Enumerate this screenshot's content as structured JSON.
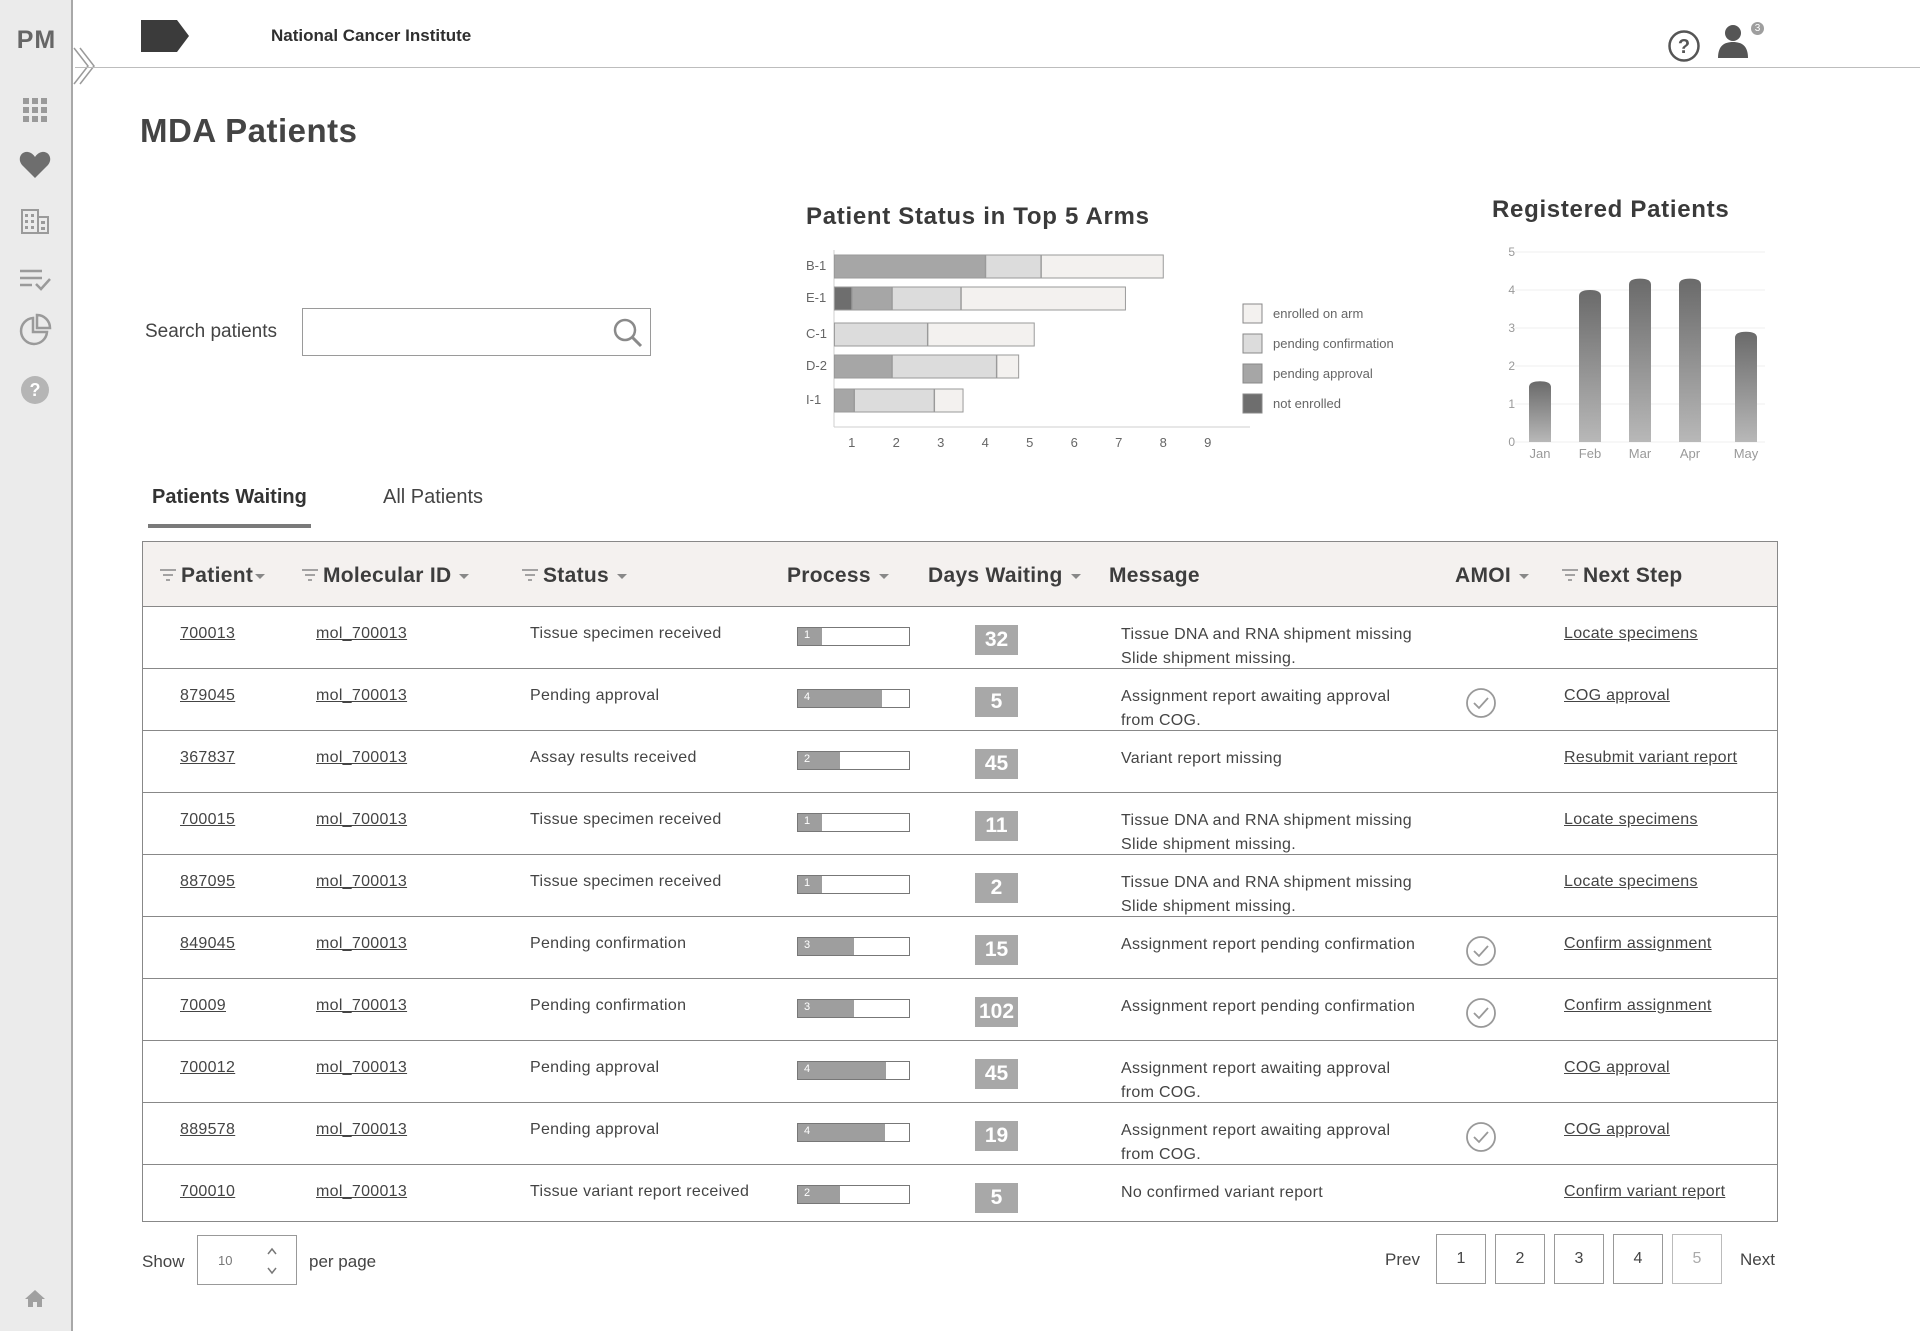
{
  "app": {
    "logo_text": "PM",
    "org_name": "National Cancer Institute",
    "notification_count": "3"
  },
  "sidebar": {
    "items": [
      {
        "icon": "grid-icon"
      },
      {
        "icon": "heart-icon"
      },
      {
        "icon": "building-icon"
      },
      {
        "icon": "checklist-icon"
      },
      {
        "icon": "pie-chart-icon"
      },
      {
        "icon": "help-icon"
      }
    ]
  },
  "page": {
    "title": "MDA Patients"
  },
  "search": {
    "label": "Search patients",
    "value": "",
    "placeholder": ""
  },
  "tabs": [
    {
      "label": "Patients Waiting",
      "active": true
    },
    {
      "label": "All Patients",
      "active": false
    }
  ],
  "table": {
    "headers": {
      "patient": "Patient",
      "molecular_id": "Molecular ID",
      "status": "Status",
      "process": "Process",
      "days_waiting": "Days Waiting",
      "message": "Message",
      "amoi": "AMOI",
      "next_step": "Next Step"
    },
    "rows": [
      {
        "patient": "700013",
        "molecular_id": "mol_700013",
        "status": "Tissue specimen received",
        "process": 1,
        "process_fill": 0.22,
        "days": "32",
        "message": [
          "Tissue DNA and RNA shipment missing",
          "Slide shipment missing."
        ],
        "amoi": false,
        "next_step": "Locate specimens"
      },
      {
        "patient": "879045",
        "molecular_id": "mol_700013",
        "status": "Pending approval",
        "process": 4,
        "process_fill": 0.76,
        "days": "5",
        "message": [
          "Assignment report awaiting approval",
          "from COG."
        ],
        "amoi": true,
        "next_step": "COG approval"
      },
      {
        "patient": "367837",
        "molecular_id": "mol_700013",
        "status": "Assay results received",
        "process": 2,
        "process_fill": 0.38,
        "days": "45",
        "message": [
          "Variant report missing",
          ""
        ],
        "amoi": false,
        "next_step": "Resubmit variant report"
      },
      {
        "patient": "700015",
        "molecular_id": "mol_700013",
        "status": "Tissue specimen received",
        "process": 1,
        "process_fill": 0.22,
        "days": "11",
        "message": [
          "Tissue DNA and RNA shipment missing",
          "Slide shipment missing."
        ],
        "amoi": false,
        "next_step": "Locate specimens"
      },
      {
        "patient": "887095",
        "molecular_id": "mol_700013",
        "status": "Tissue specimen received",
        "process": 1,
        "process_fill": 0.22,
        "days": "2",
        "message": [
          "Tissue DNA and RNA shipment missing",
          "Slide shipment missing."
        ],
        "amoi": false,
        "next_step": "Locate specimens"
      },
      {
        "patient": "849045",
        "molecular_id": "mol_700013",
        "status": "Pending confirmation",
        "process": 3,
        "process_fill": 0.5,
        "days": "15",
        "message": [
          "Assignment report pending confirmation",
          ""
        ],
        "amoi": true,
        "next_step": "Confirm assignment"
      },
      {
        "patient": "70009",
        "molecular_id": "mol_700013",
        "status": "Pending confirmation",
        "process": 3,
        "process_fill": 0.5,
        "days": "102",
        "message": [
          "Assignment report pending confirmation",
          ""
        ],
        "amoi": true,
        "next_step": "Confirm assignment"
      },
      {
        "patient": "700012",
        "molecular_id": "mol_700013",
        "status": "Pending approval",
        "process": 4,
        "process_fill": 0.79,
        "days": "45",
        "message": [
          "Assignment report awaiting approval",
          "from COG."
        ],
        "amoi": false,
        "next_step": "COG approval"
      },
      {
        "patient": "889578",
        "molecular_id": "mol_700013",
        "status": "Pending approval",
        "process": 4,
        "process_fill": 0.78,
        "days": "19",
        "message": [
          "Assignment report awaiting approval",
          "from COG."
        ],
        "amoi": true,
        "next_step": "COG approval"
      },
      {
        "patient": "700010",
        "molecular_id": "mol_700013",
        "status": "Tissue variant report received",
        "process": 2,
        "process_fill": 0.38,
        "days": "5",
        "message": [
          "No confirmed variant report",
          ""
        ],
        "amoi": false,
        "next_step": "Confirm variant report"
      }
    ]
  },
  "pagination": {
    "show_label": "Show",
    "per_page_value": "10",
    "per_page_label": "per page",
    "prev_label": "Prev",
    "next_label": "Next",
    "pages": [
      "1",
      "2",
      "3",
      "4",
      "5"
    ]
  },
  "colors": {
    "not_enrolled": "#6e6e6e",
    "pending_approval": "#a6a6a6",
    "pending_confirmation": "#dcdcdc",
    "enrolled_on_arm": "#f3f1ef"
  },
  "chart_data": [
    {
      "type": "bar",
      "orientation": "horizontal",
      "stacked": true,
      "title": "Patient Status in Top 5 Arms",
      "categories": [
        "B-1",
        "E-1",
        "C-1",
        "D-2",
        "I-1"
      ],
      "x_ticks": [
        "1",
        "2",
        "3",
        "4",
        "5",
        "6",
        "7",
        "8",
        "9"
      ],
      "xlim": [
        0.6,
        9.5
      ],
      "series": [
        {
          "name": "not enrolled",
          "values": [
            0,
            0.4,
            0,
            0,
            0
          ]
        },
        {
          "name": "pending approval",
          "values": [
            3.4,
            0.9,
            0,
            1.3,
            0.45
          ]
        },
        {
          "name": "pending confirmation",
          "values": [
            1.25,
            1.55,
            2.1,
            2.35,
            1.8
          ]
        },
        {
          "name": "enrolled on arm",
          "values": [
            2.75,
            3.7,
            2.4,
            0.5,
            0.65
          ]
        }
      ],
      "legend": [
        "enrolled on arm",
        "pending confirmation",
        "pending approval",
        "not enrolled"
      ],
      "legend_position": "right"
    },
    {
      "type": "bar",
      "title": "Registered Patients",
      "categories": [
        "Jan",
        "Feb",
        "Mar",
        "Apr",
        "May"
      ],
      "values": [
        1.6,
        4.0,
        4.3,
        4.3,
        2.9
      ],
      "y_ticks": [
        "0",
        "1",
        "2",
        "3",
        "4",
        "5"
      ],
      "ylim": [
        0,
        5
      ]
    }
  ]
}
